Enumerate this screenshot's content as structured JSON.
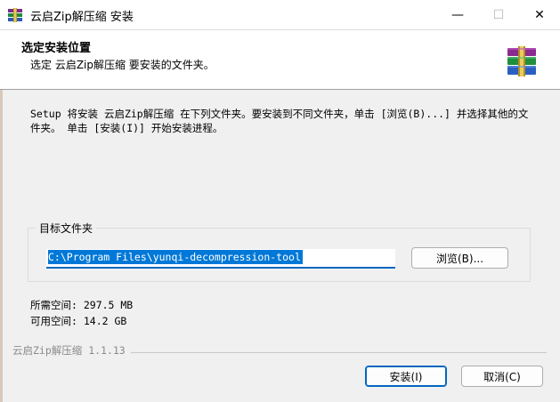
{
  "window": {
    "title": "云启Zip解压缩 安装",
    "minimize_glyph": "—",
    "maximize_glyph": "☐",
    "close_glyph": "✕"
  },
  "header": {
    "title": "选定安装位置",
    "subtitle": "选定 云启Zip解压缩 要安装的文件夹。"
  },
  "body": {
    "description": "Setup 将安装 云启Zip解压缩 在下列文件夹。要安装到不同文件夹，单击 [浏览(B)...] 并选择其他的文件夹。 单击 [安装(I)] 开始安装进程。"
  },
  "destination": {
    "group_label": "目标文件夹",
    "path_value": "C:\\Program Files\\yunqi-decompression-tool",
    "browse_label": "浏览(B)..."
  },
  "space": {
    "required": "所需空间: 297.5 MB",
    "available": "可用空间: 14.2 GB"
  },
  "footer": {
    "version": "云启Zip解压缩 1.1.13",
    "install_label": "安装(I)",
    "cancel_label": "取消(C)"
  },
  "icons": {
    "app": "winrar-books-icon",
    "header": "winrar-books-icon"
  },
  "colors": {
    "accent": "#0078d7",
    "selection_bg": "#0078d7"
  }
}
